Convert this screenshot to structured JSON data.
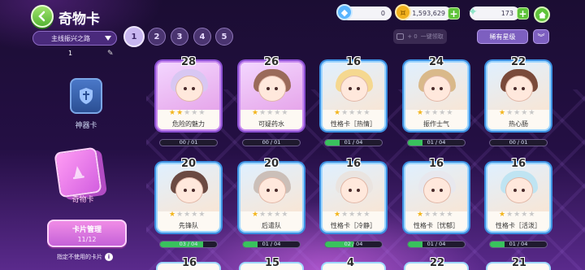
{
  "header": {
    "title": "奇物卡",
    "currency": [
      {
        "name": "diamond",
        "value": "0",
        "color": "#5ab6ff"
      },
      {
        "name": "coin",
        "value": "1,593,629",
        "color": "#f2b21d"
      },
      {
        "name": "wings",
        "value": "173",
        "color": "#8fe6c8"
      }
    ]
  },
  "filters": {
    "route": "主线振兴之路",
    "route_count": "1",
    "pages": [
      "1",
      "2",
      "3",
      "4",
      "5"
    ],
    "active_page": "1",
    "collect_plus": "+ 0",
    "collect_label": "一键领取",
    "rare_label": "稀有星级"
  },
  "sidebar": {
    "artifact_label": "神器卡",
    "mystery_label": "奇物卡",
    "manage_title": "卡片管理",
    "manage_count": "11/12",
    "unused_note": "指定不使用的卡片"
  },
  "cards": [
    {
      "level": "28",
      "name": "危险的魅力",
      "stars": 2,
      "progress": "00 / 01",
      "fill": 0.0,
      "frame": "purple",
      "hair": "#d8c7f2"
    },
    {
      "level": "26",
      "name": "可疑药水",
      "stars": 1,
      "progress": "00 / 01",
      "fill": 0.0,
      "frame": "purple",
      "hair": "#9a6a5a"
    },
    {
      "level": "16",
      "name": "性格卡［热情］",
      "stars": 1,
      "progress": "01 / 04",
      "fill": 0.25,
      "frame": "blue",
      "hair": "#f5d890"
    },
    {
      "level": "24",
      "name": "振作士气",
      "stars": 1,
      "progress": "01 / 04",
      "fill": 0.25,
      "frame": "blue",
      "hair": "#d9b98a"
    },
    {
      "level": "22",
      "name": "热心肠",
      "stars": 1,
      "progress": "00 / 01",
      "fill": 0.0,
      "frame": "blue",
      "hair": "#7a4a3a"
    },
    {
      "level": "20",
      "name": "先锋队",
      "stars": 1,
      "progress": "03 / 04",
      "fill": 0.75,
      "frame": "blue",
      "hair": "#6b4a42"
    },
    {
      "level": "20",
      "name": "后遣队",
      "stars": 1,
      "progress": "01 / 04",
      "fill": 0.25,
      "frame": "blue",
      "hair": "#cbbfb8"
    },
    {
      "level": "16",
      "name": "性格卡［冷静］",
      "stars": 1,
      "progress": "02 / 04",
      "fill": 0.5,
      "frame": "blue",
      "hair": "#eae4e0"
    },
    {
      "level": "16",
      "name": "性格卡［忧郁］",
      "stars": 1,
      "progress": "01 / 04",
      "fill": 0.25,
      "frame": "blue",
      "hair": "#e8e8ee"
    },
    {
      "level": "16",
      "name": "性格卡［活泼］",
      "stars": 1,
      "progress": "01 / 04",
      "fill": 0.25,
      "frame": "blue",
      "hair": "#bfe4f2"
    }
  ],
  "next_row_levels": [
    "16",
    "15",
    "4",
    "22",
    "21"
  ]
}
